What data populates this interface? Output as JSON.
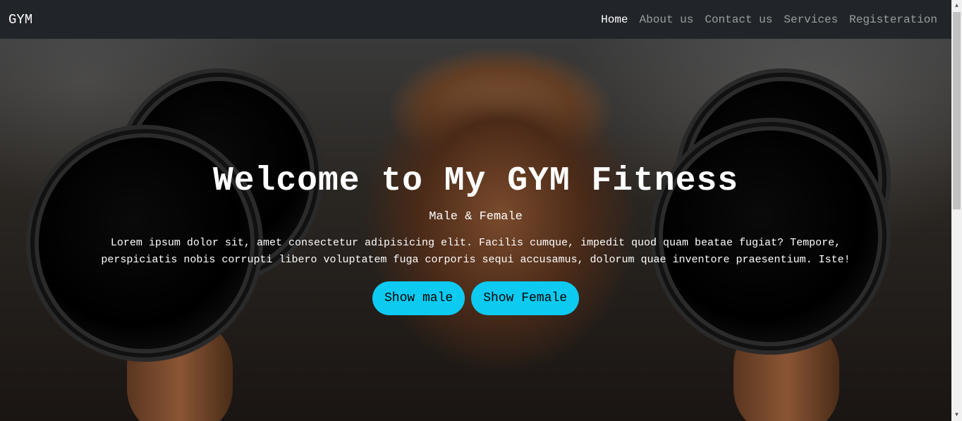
{
  "nav": {
    "brand": "GYM",
    "links": [
      {
        "label": "Home",
        "active": true
      },
      {
        "label": "About us",
        "active": false
      },
      {
        "label": "Contact us",
        "active": false
      },
      {
        "label": "Services",
        "active": false
      },
      {
        "label": "Registeration",
        "active": false
      }
    ]
  },
  "hero": {
    "title": "Welcome to My GYM Fitness",
    "subtitle": "Male & Female",
    "lead": "Lorem ipsum dolor sit, amet consectetur adipisicing elit. Facilis cumque, impedit quod quam beatae fugiat? Tempore, perspiciatis nobis corrupti libero voluptatem fuga corporis sequi accusamus, dolorum quae inventore praesentium. Iste!",
    "buttons": {
      "male": "Show male",
      "female": "Show Female"
    }
  },
  "colors": {
    "navbar": "#212529",
    "button": "#0dcaf0"
  },
  "icons": {
    "scroll_up": "triangle-up-icon",
    "scroll_down": "triangle-down-icon"
  }
}
